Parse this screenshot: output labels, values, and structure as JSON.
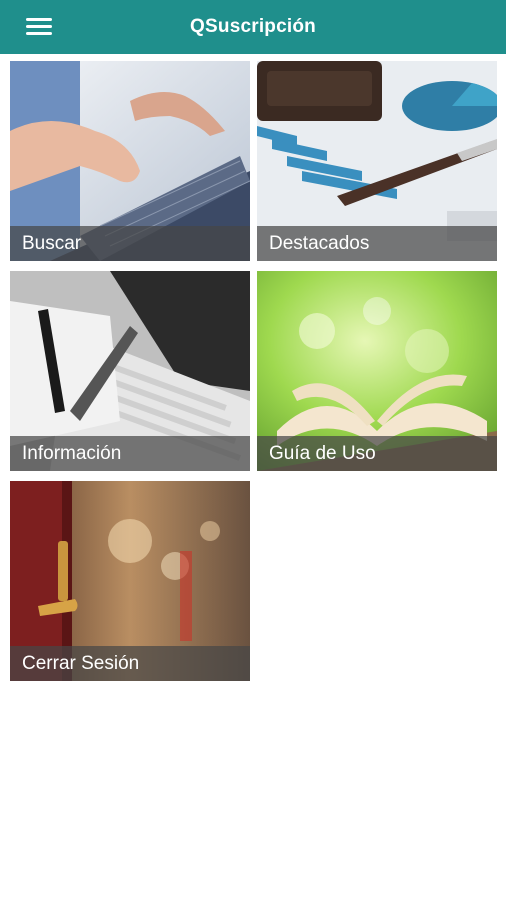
{
  "app": {
    "title": "QSuscripción",
    "accent": "#1f8f8c"
  },
  "menu": {
    "icon": "hamburger-menu-icon"
  },
  "tiles": [
    {
      "label": "Buscar",
      "image": "hands-typing-on-laptop"
    },
    {
      "label": "Destacados",
      "image": "pen-chart-wallet"
    },
    {
      "label": "Información",
      "image": "notebook-pen-laptop"
    },
    {
      "label": "Guía de Uso",
      "image": "open-book-green-bokeh"
    },
    {
      "label": "Cerrar Sesión",
      "image": "door-handle-corridor"
    }
  ]
}
